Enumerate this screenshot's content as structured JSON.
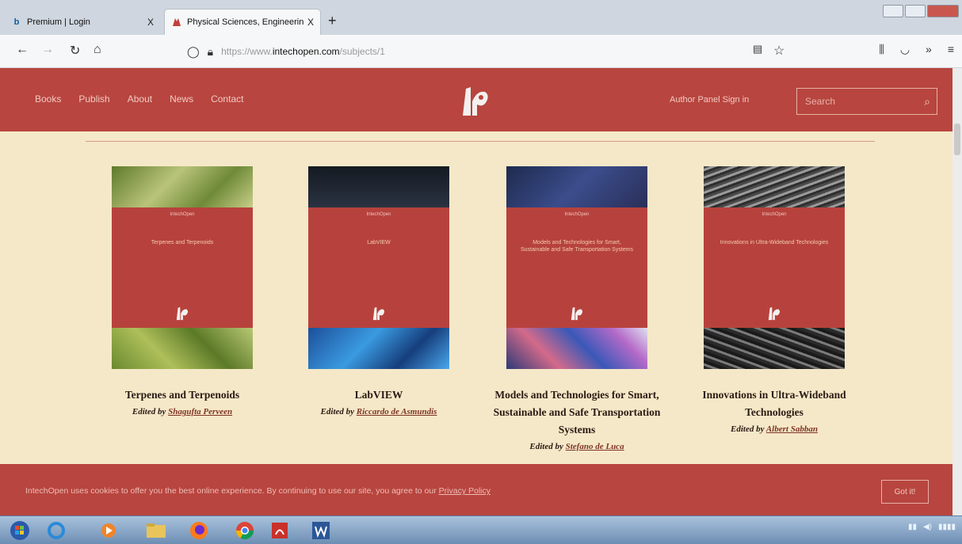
{
  "browser": {
    "tabs": [
      {
        "title": "Premium | Login",
        "favicon": "b"
      },
      {
        "title": "Physical Sciences, Engineering",
        "favicon": "IN"
      }
    ],
    "close_glyph": "X",
    "new_tab": "+",
    "url_prefix": "https://www.",
    "url_host": "intechopen.com",
    "url_path": "/subjects/1"
  },
  "site": {
    "nav": [
      "Books",
      "Publish",
      "About",
      "News",
      "Contact"
    ],
    "author_link": "Author Panel Sign in",
    "search_placeholder": "Search"
  },
  "books": [
    {
      "title": "Terpenes and Terpenoids",
      "editor_prefix": "Edited by",
      "editor": "Shagufta Perveen",
      "cover_title": "Terpenes and Terpenoids",
      "cover_colors": [
        "#7a8a3a",
        "#b7c06a"
      ]
    },
    {
      "title": "LabVIEW",
      "editor_prefix": "Edited by",
      "editor": "Riccardo de Asmundis",
      "cover_title": "LabVIEW",
      "cover_colors": [
        "#1d2430",
        "#2d7fc2"
      ]
    },
    {
      "title": "Models and Technologies for Smart, Sustainable and Safe Transportation Systems",
      "editor_prefix": "Edited by",
      "editor": "Stefano de Luca",
      "cover_title": "Models and Technologies for Smart, Sustainable and Safe Transportation Systems",
      "cover_colors": [
        "#2a3f6e",
        "#8b5aa8"
      ]
    },
    {
      "title": "Innovations in Ultra-Wideband Technologies",
      "editor_prefix": "Edited by",
      "editor": "Albert Sabban",
      "cover_title": "Innovations in Ultra-Wideband Technologies",
      "cover_colors": [
        "#6b6b6b",
        "#3a3a3a"
      ]
    }
  ],
  "cookie": {
    "text": "IntechOpen uses cookies to offer you the best online experience. By continuing to use our site, you agree to our",
    "policy_link": "Privacy Policy",
    "button": "Got it!"
  },
  "colors": {
    "header_bg": "#b8453f",
    "page_bg": "#f5e8c8",
    "accent_text": "#7f3426"
  }
}
